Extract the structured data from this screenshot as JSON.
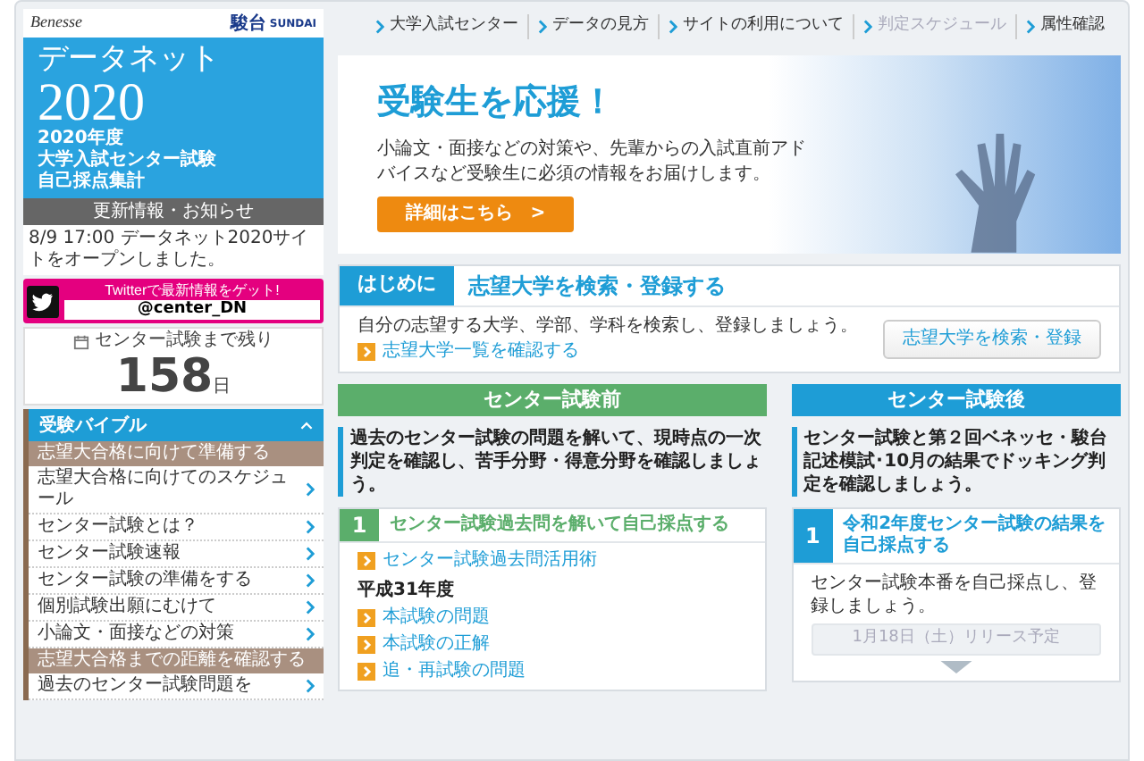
{
  "logos": {
    "benesse": "Benesse",
    "sundai": "駿台",
    "sundai_sub": "SUNDAI"
  },
  "hero": {
    "title": "データネット",
    "year": "2020",
    "lines": [
      "2020年度",
      "大学入試センター試験",
      "自己採点集計"
    ]
  },
  "news": {
    "heading": "更新情報・お知らせ",
    "items": [
      "8/9 17:00 データネット2020サイトをオープンしました。"
    ]
  },
  "twitter": {
    "text": "Twitterで最新情報をゲット!",
    "handle": "@center_DN"
  },
  "countdown": {
    "label": "センター試験まで残り",
    "days": "158",
    "unit": "日"
  },
  "sidebar": {
    "title": "受験バイブル",
    "expanded": true,
    "items": [
      {
        "kind": "section",
        "label": "志望大合格に向けて準備する"
      },
      {
        "kind": "link",
        "label": "志望大合格に向けてのスケジュール"
      },
      {
        "kind": "link",
        "label": "センター試験とは？"
      },
      {
        "kind": "link",
        "label": "センター試験速報"
      },
      {
        "kind": "link",
        "label": "センター試験の準備をする"
      },
      {
        "kind": "link",
        "label": "個別試験出願にむけて"
      },
      {
        "kind": "link",
        "label": "小論文・面接などの対策"
      },
      {
        "kind": "section",
        "label": "志望大合格までの距離を確認する"
      },
      {
        "kind": "link",
        "label": "過去のセンター試験問題を"
      }
    ]
  },
  "top_nav": [
    {
      "label": "大学入試センター",
      "disabled": false
    },
    {
      "label": "データの見方",
      "disabled": false
    },
    {
      "label": "サイトの利用について",
      "disabled": false
    },
    {
      "label": "判定スケジュール",
      "disabled": true
    },
    {
      "label": "属性確認",
      "disabled": false
    }
  ],
  "banner": {
    "title": "受験生を応援！",
    "text": "小論文・面接などの対策や、先輩からの入試直前アドバイスなど受験生に必須の情報をお届けします。",
    "button": "詳細はこちら　>"
  },
  "intro": {
    "tab": "はじめに",
    "title": "志望大学を検索・登録する",
    "text": "自分の志望する大学、学部、学科を検索し、登録しましょう。",
    "link": "志望大学一覧を確認する",
    "button": "志望大学を検索・登録"
  },
  "columns": [
    {
      "title": "センター試験前",
      "color": "#5bae6b",
      "text": "過去のセンター試験の問題を解いて、現時点の一次判定を確認し、苦手分野・得意分野を確認しましょう。",
      "step": {
        "number": "1",
        "title": "センター試験過去問を解いて自己採点する"
      },
      "items": [
        {
          "kind": "link",
          "label": "センター試験過去問活用術"
        },
        {
          "kind": "heading",
          "label": "平成31年度"
        },
        {
          "kind": "link",
          "label": "本試験の問題"
        },
        {
          "kind": "link",
          "label": "本試験の正解"
        },
        {
          "kind": "link",
          "label": "追・再試験の問題"
        }
      ]
    },
    {
      "title": "センター試験後",
      "color": "#1e9dd6",
      "text": "センター試験と第２回ベネッセ・駿台記述模試･10月の結果でドッキング判定を確認しましょう。",
      "step": {
        "number": "1",
        "title": "令和2年度センター試験の結果を自己採点する"
      },
      "items": [
        {
          "kind": "text",
          "label": "センター試験本番を自己採点し、登録しましょう。"
        },
        {
          "kind": "button",
          "label": "1月18日（土）リリース予定",
          "disabled": true
        },
        {
          "kind": "arrow"
        }
      ]
    }
  ]
}
